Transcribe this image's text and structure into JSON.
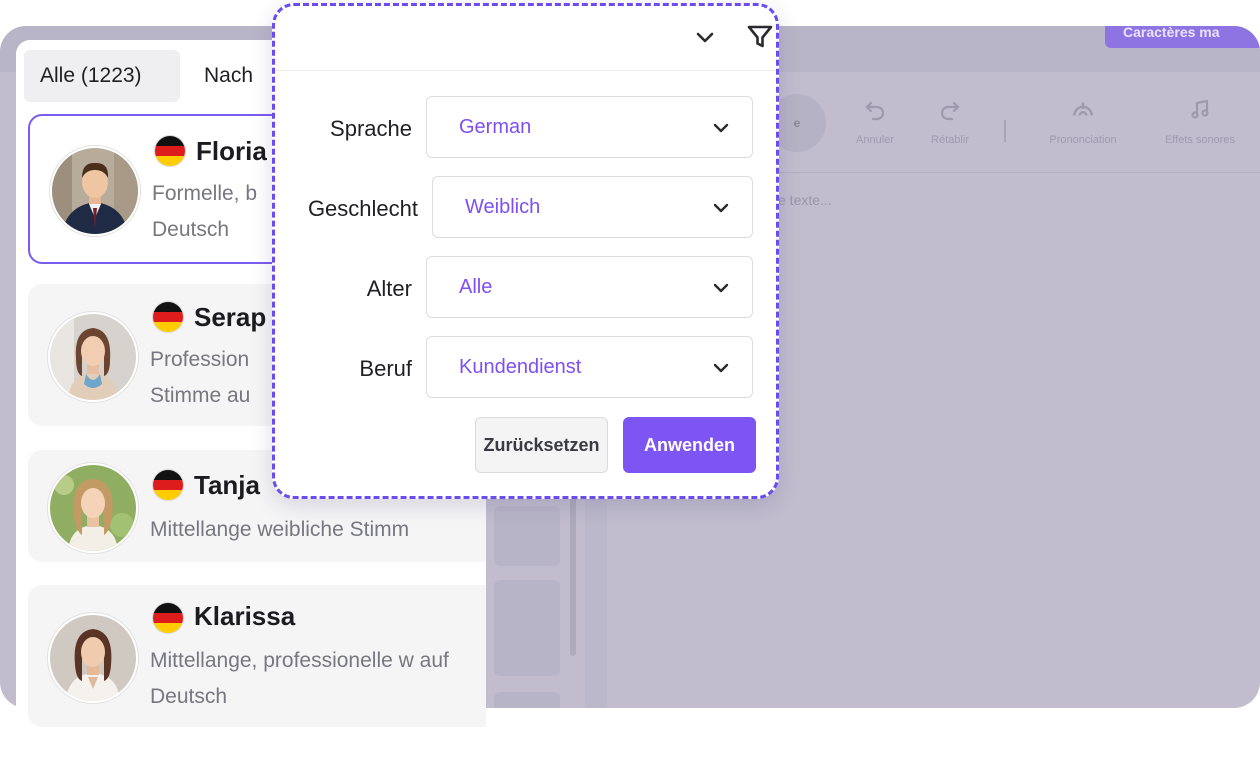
{
  "background": {
    "cta_label": "Caractères ma",
    "toolbar": {
      "chip_label": "e",
      "undo_label": "Annuler",
      "redo_label": "Rétablir",
      "pronunciation_label": "Prononciation",
      "sound_effects_label": "Effets sonores"
    },
    "editor_placeholder": "e texte..."
  },
  "tabs": [
    {
      "label": "Alle (1223)",
      "active": true
    },
    {
      "label": "Nach"
    }
  ],
  "voices": [
    {
      "name": "Floria",
      "description": "Formelle, b Deutsch",
      "flag": "de-flag",
      "selected": true
    },
    {
      "name": "Serap",
      "description": "Profession Stimme au",
      "flag": "de-flag"
    },
    {
      "name": "Tanja",
      "description": "Mittellange weibliche Stimm",
      "flag": "de-flag"
    },
    {
      "name": "Klarissa",
      "description": "Mittellange, professionelle w auf Deutsch",
      "flag": "de-flag"
    }
  ],
  "filter": {
    "header_icons": [
      "chevron-down-icon",
      "filter-icon"
    ],
    "fields": [
      {
        "label": "Sprache",
        "value": "German"
      },
      {
        "label": "Geschlecht",
        "value": "Weiblich"
      },
      {
        "label": "Alter",
        "value": "Alle"
      },
      {
        "label": "Beruf",
        "value": "Kundendienst"
      }
    ],
    "reset_label": "Zurücksetzen",
    "apply_label": "Anwenden"
  },
  "colors": {
    "accent": "#7c55f3",
    "selected_border": "#7b5cf0",
    "select_value": "#7e4ff2",
    "popup_dash": "#6a4cf0"
  }
}
